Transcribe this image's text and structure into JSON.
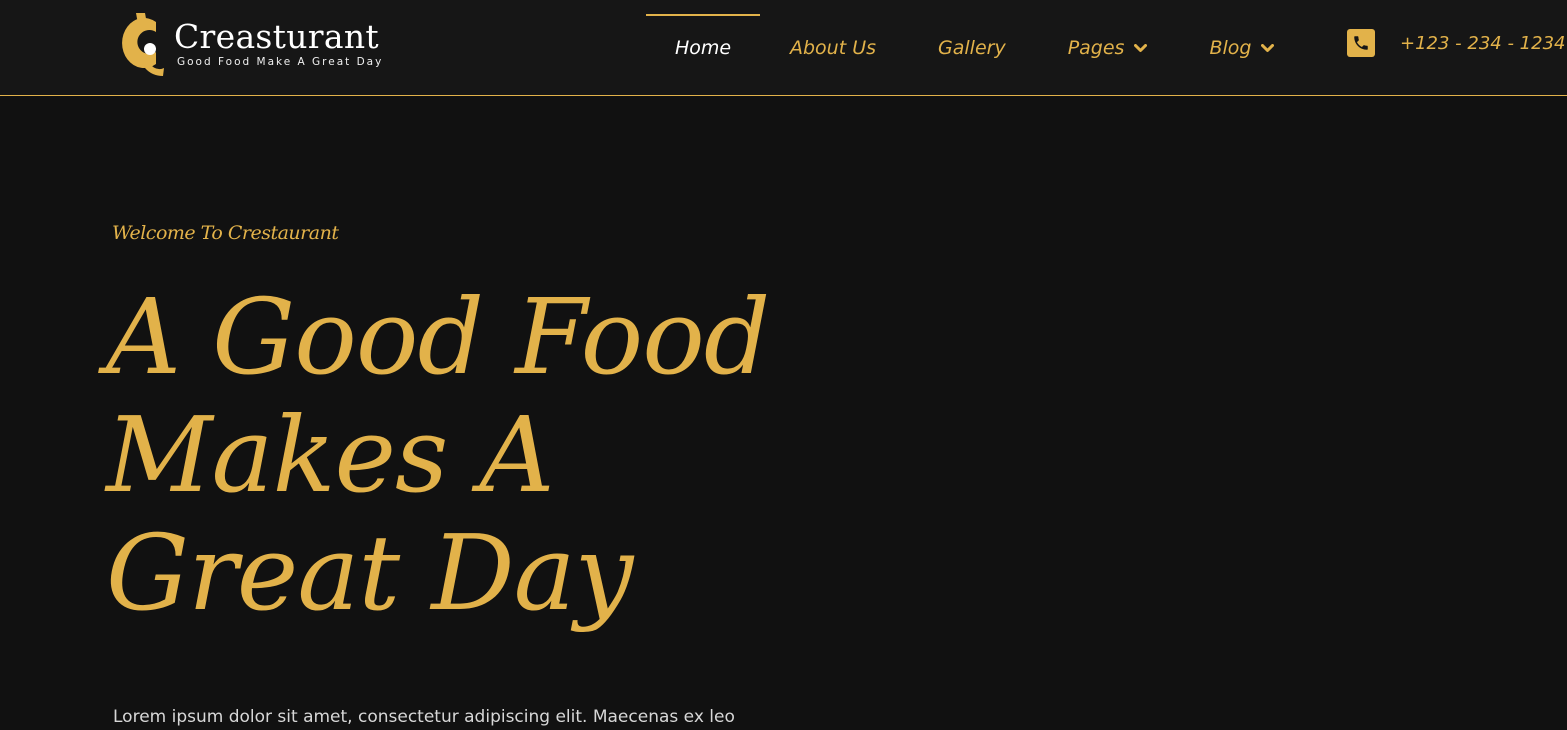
{
  "colors": {
    "background": "#111111",
    "header_background": "#161616",
    "accent": "#e2b24a",
    "text_light": "#ffffff"
  },
  "brand": {
    "name": "Creasturant",
    "tagline": "Good Food Make A Great Day",
    "logo_icon": "c-logo-icon"
  },
  "nav": {
    "items": [
      {
        "label": "Home",
        "active": true
      },
      {
        "label": "About Us",
        "active": false
      },
      {
        "label": "Gallery",
        "active": false
      },
      {
        "label": "Pages",
        "active": false,
        "dropdown": true
      },
      {
        "label": "Blog",
        "active": false,
        "dropdown": true
      }
    ],
    "dropdown_icon": "chevron-down-icon"
  },
  "contact": {
    "phone_icon": "phone-icon",
    "phone": "+123 - 234 - 1234"
  },
  "hero": {
    "eyebrow": "Welcome To Crestaurant",
    "headline_lines": [
      "A Good Food",
      "Makes A",
      "Great Day"
    ],
    "body": "Lorem ipsum dolor sit amet, consectetur adipiscing elit. Maecenas ex leo"
  }
}
